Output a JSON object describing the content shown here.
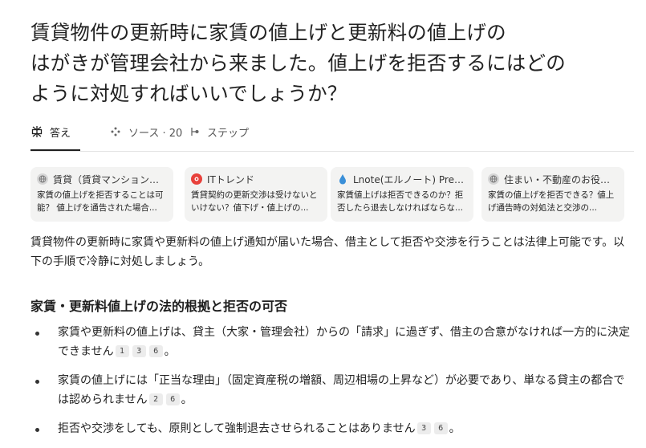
{
  "question": {
    "line1": "賃貸物件の更新時に家賃の値上げと更新料の値上げの",
    "line2": "はがきが管理会社から来ました。値上げを拒否するにはどの",
    "line3": "ように対処すればいいでしょうか？"
  },
  "tabs": [
    {
      "label": "答え",
      "icon": "perplexity-logo-icon"
    },
    {
      "label": "ソース · 20",
      "icon": "sources-icon"
    },
    {
      "label": "ステップ",
      "icon": "steps-icon"
    }
  ],
  "sources": [
    {
      "name": "賃貸（賃貸マンション・アパ...",
      "snippet": "家賃の値上げを拒否することは可能？ 値上げを通告された場合...",
      "icon": "globe-icon",
      "color": "#cfcfcf"
    },
    {
      "name": "ITトレンド",
      "snippet": "賃貸契約の更新交渉は受けないといけない？値下げ・値上げの...",
      "icon": "ittrend-icon",
      "color": "#e8413b"
    },
    {
      "name": "Lnote(エルノート) Present...",
      "snippet": "家賃値上げは拒否できるのか？拒否したら退去しなければならな...",
      "icon": "drop-icon",
      "color": "#3a8fd8"
    },
    {
      "name": "住まい・不動産のお役立ち...",
      "snippet": "家賃の値上げを拒否できる？値上げ通告時の対処法と交渉の...",
      "icon": "globe-icon",
      "color": "#cfcfcf"
    }
  ],
  "answer": {
    "intro": "賃貸物件の更新時に家賃や更新料の値上げ通知が届いた場合、借主として拒否や交渉を行うことは法律上可能です。以下の手順で冷静に対処しましょう。",
    "heading": "家賃・更新料値上げの法的根拠と拒否の可否",
    "bullets": [
      {
        "text": "家賃や更新料の値上げは、貸主（大家・管理会社）からの「請求」に過ぎず、借主の合意がなければ一方的に決定できません",
        "cites": [
          "1",
          "3",
          "6"
        ],
        "end": "。"
      },
      {
        "text": "家賃の値上げには「正当な理由」（固定資産税の増額、周辺相場の上昇など）が必要であり、単なる貸主の都合では認められません",
        "cites": [
          "2",
          "6"
        ],
        "end": "。"
      },
      {
        "text": "拒否や交渉をしても、原則として強制退去させられることはありません",
        "cites": [
          "3",
          "6"
        ],
        "end": "。"
      }
    ]
  }
}
